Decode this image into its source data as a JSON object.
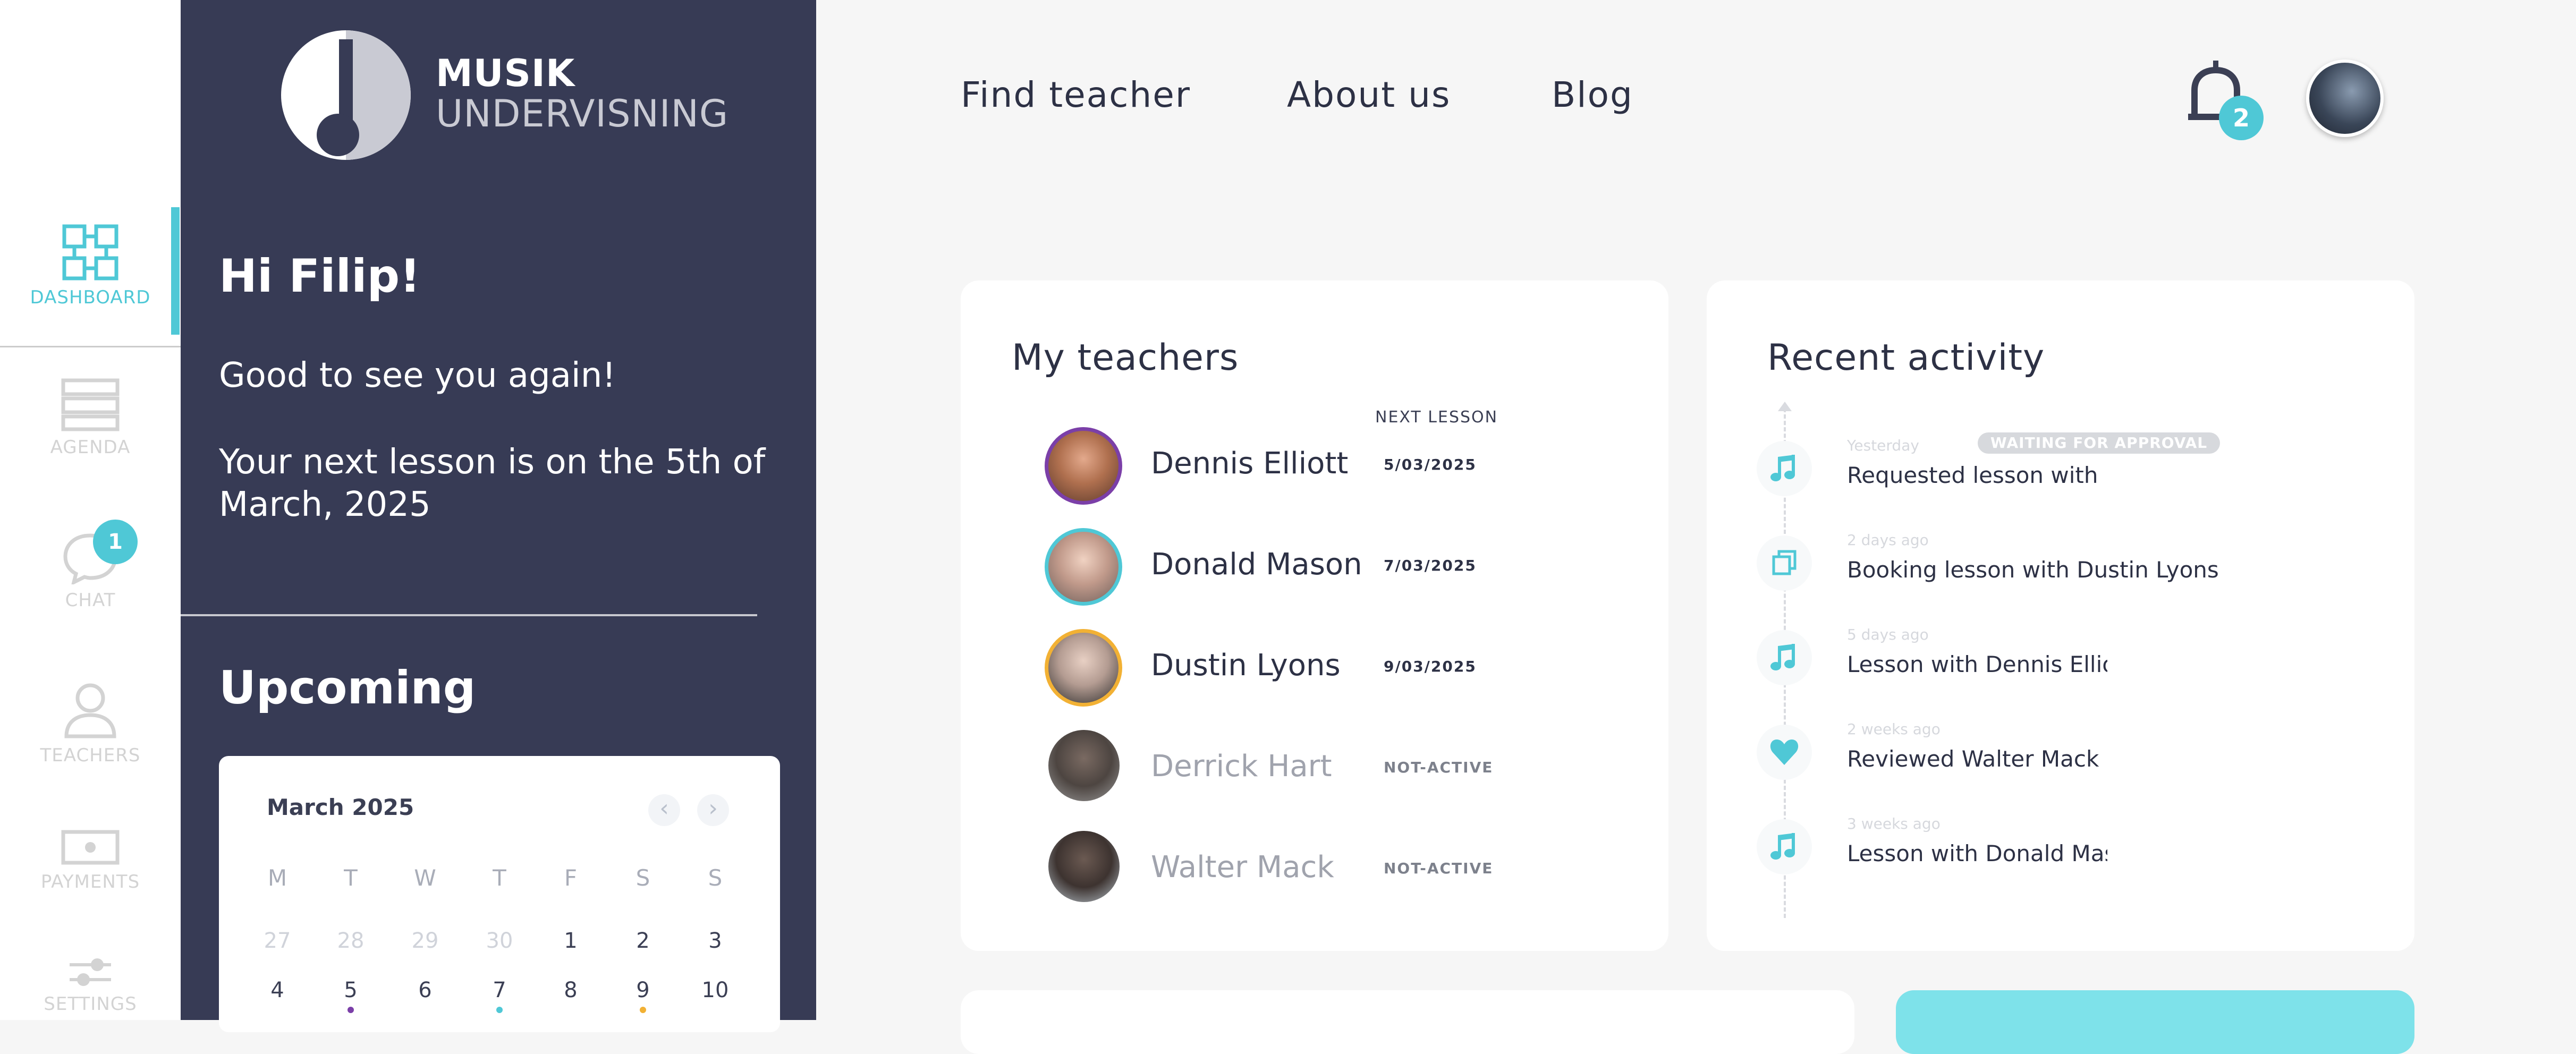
{
  "rail": {
    "items": [
      {
        "label": "DASHBOARD",
        "icon": "dashboard-grid-icon",
        "active": true
      },
      {
        "label": "AGENDA",
        "icon": "agenda-icon"
      },
      {
        "label": "CHAT",
        "icon": "chat-icon",
        "badge": "1"
      },
      {
        "label": "TEACHERS",
        "icon": "teacher-person-icon"
      },
      {
        "label": "PAYMENTS",
        "icon": "payments-icon"
      },
      {
        "label": "SETTINGS",
        "icon": "settings-sliders-icon"
      }
    ]
  },
  "brand": {
    "line1": "MUSIK",
    "line2": "UNDERVISNING"
  },
  "panel": {
    "greeting": "Hi Filip!",
    "welcome": "Good to see you again!",
    "next_lesson": "Your next lesson is on the 5th of March, 2025",
    "upcoming_title": "Upcoming"
  },
  "calendar": {
    "month": "March 2025",
    "prev": "‹",
    "next": "›",
    "weekdays": [
      "M",
      "T",
      "W",
      "T",
      "F",
      "S",
      "S"
    ],
    "row1": [
      "27",
      "28",
      "29",
      "30",
      "1",
      "2",
      "3"
    ],
    "row2": [
      "4",
      "5",
      "6",
      "7",
      "8",
      "9",
      "10"
    ]
  },
  "nav": {
    "links": [
      "Find teacher",
      "About us",
      "Blog"
    ],
    "notification_count": "2"
  },
  "teachers": {
    "title": "My teachers",
    "next_lesson_header": "NEXT LESSON",
    "rows": [
      {
        "name": "Dennis Elliott",
        "next": "5/03/2025",
        "ring": "#7b3fa8",
        "active": true
      },
      {
        "name": "Donald Mason",
        "next": "7/03/2025",
        "ring": "#4fc8d6",
        "active": true
      },
      {
        "name": "Dustin Lyons",
        "next": "9/03/2025",
        "ring": "#f2b134",
        "active": true
      },
      {
        "name": "Derrick Hart",
        "next": "NOT-ACTIVE",
        "active": false
      },
      {
        "name": "Walter Mack",
        "next": "NOT-ACTIVE",
        "active": false
      }
    ]
  },
  "activity": {
    "title": "Recent activity",
    "items": [
      {
        "time": "Yesterday",
        "text": "Requested lesson with Dustin Lyons",
        "icon": "music-note-icon",
        "badge": "WAITING FOR APPROVAL"
      },
      {
        "time": "2 days ago",
        "text": "Booking lesson with Dustin Lyons",
        "icon": "copy-booking-icon"
      },
      {
        "time": "5 days ago",
        "text": "Lesson with Dennis Elliott",
        "icon": "music-note-icon"
      },
      {
        "time": "2 weeks ago",
        "text": "Reviewed Walter Mack",
        "icon": "heart-icon"
      },
      {
        "time": "3 weeks ago",
        "text": "Lesson with Donald Mason",
        "icon": "music-note-icon"
      }
    ]
  },
  "colors": {
    "accent": "#4fc8d6",
    "panel": "#373b55",
    "background": "#f6f6f6",
    "purple_dot": "#7b3fa8",
    "orange_dot": "#f2b134"
  }
}
